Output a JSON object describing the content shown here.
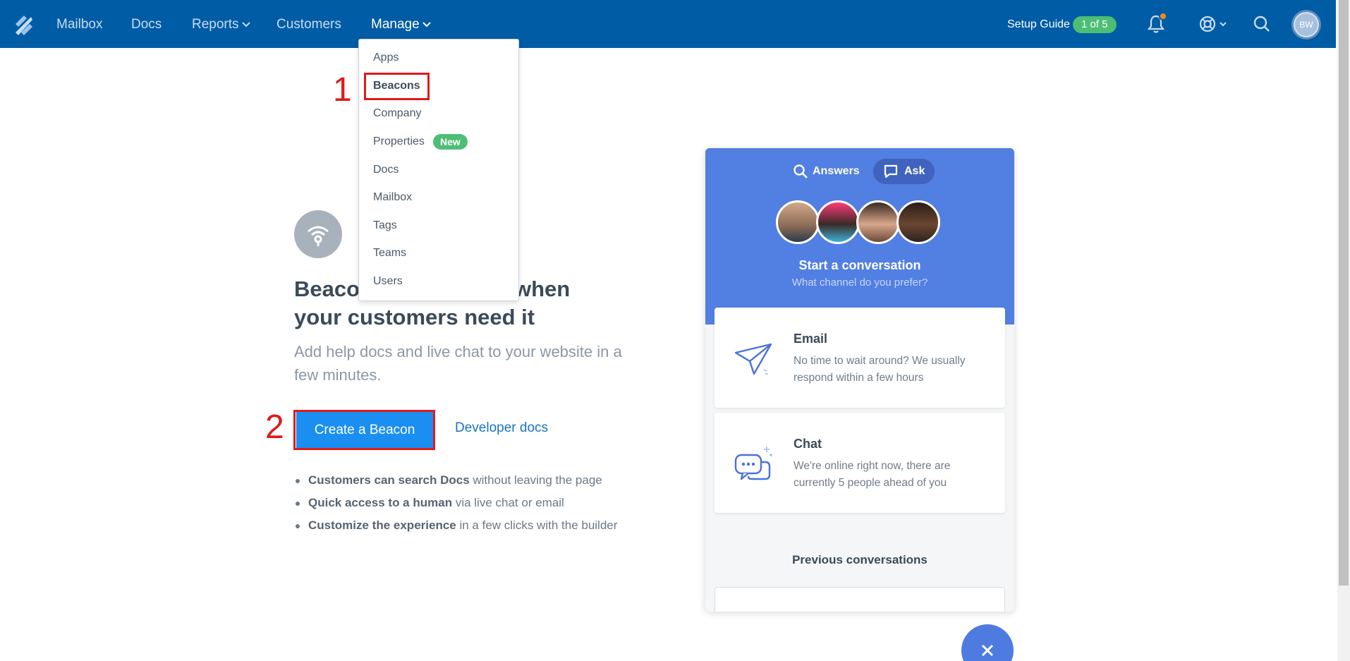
{
  "nav": {
    "items": [
      {
        "label": "Mailbox"
      },
      {
        "label": "Docs"
      },
      {
        "label": "Reports"
      },
      {
        "label": "Customers"
      },
      {
        "label": "Manage"
      }
    ],
    "setup_guide_label": "Setup Guide",
    "setup_guide_progress": "1 of 5",
    "avatar_initials": "BW"
  },
  "manage_menu": {
    "items": [
      "Apps",
      "Beacons",
      "Company",
      "Properties",
      "Docs",
      "Mailbox",
      "Tags",
      "Teams",
      "Users"
    ],
    "properties_badge": "New"
  },
  "annotations": {
    "step1": "1",
    "step2": "2"
  },
  "main": {
    "headline": "Beacon help right when your customers need it",
    "headline_line1_visible_end": ": when",
    "headline_line2": "your customers need it",
    "headline_line1_start": "Beaco",
    "subline": "Add help docs and live chat to your website in a few minutes.",
    "create_button": "Create a Beacon",
    "developer_link": "Developer docs",
    "bullets": [
      {
        "strong": "Customers can search Docs",
        "rest": " without leaving the page"
      },
      {
        "strong": "Quick access to a human",
        "rest": " via live chat or email"
      },
      {
        "strong": "Customize the experience",
        "rest": " in a few clicks with the builder"
      }
    ]
  },
  "preview": {
    "tabs": [
      "Answers",
      "Ask"
    ],
    "title": "Start a conversation",
    "subtitle": "What channel do you prefer?",
    "cards": [
      {
        "title": "Email",
        "desc": "No time to wait around? We usually respond within a few hours"
      },
      {
        "title": "Chat",
        "desc": "We're online right now, there are currently 5 people ahead of you"
      }
    ],
    "previous": "Previous conversations"
  },
  "colors": {
    "nav_bg": "#005ca4",
    "beacon_blue": "#527fe2",
    "cta_blue": "#1a8ff1",
    "highlight_red": "#e01a1a",
    "badge_green": "#4cbf74"
  }
}
